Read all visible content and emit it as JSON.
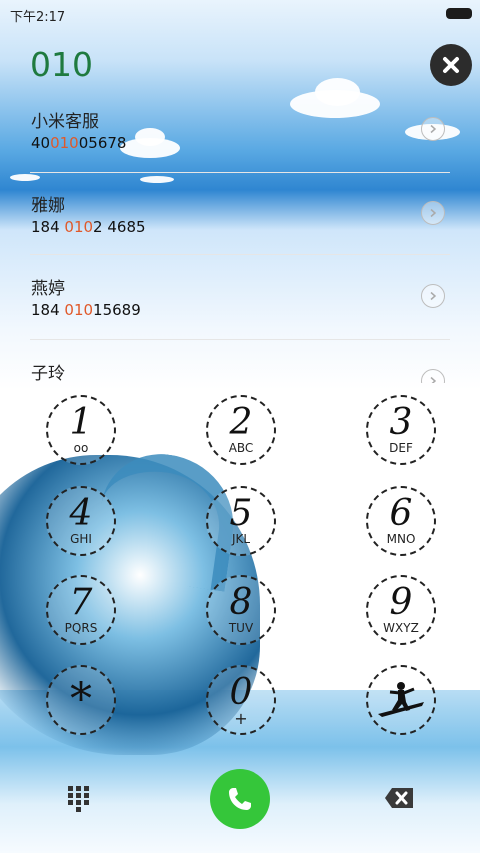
{
  "status_bar": {
    "time": "下午2:17"
  },
  "query": "010",
  "contacts": [
    {
      "name": "小米客服",
      "number_pre": "40",
      "number_hl": "010",
      "number_post": "05678"
    },
    {
      "name": "雅娜",
      "number_pre": "184 ",
      "number_hl": "010",
      "number_post": "2 4685"
    },
    {
      "name": "燕婷",
      "number_pre": "184 ",
      "number_hl": "010",
      "number_post": "15689"
    },
    {
      "name": "子玲",
      "number_pre": "",
      "number_hl": "",
      "number_post": ""
    }
  ],
  "keypad": [
    {
      "digit": "1",
      "letters": "oo"
    },
    {
      "digit": "2",
      "letters": "ABC"
    },
    {
      "digit": "3",
      "letters": "DEF"
    },
    {
      "digit": "4",
      "letters": "GHI"
    },
    {
      "digit": "5",
      "letters": "JKL"
    },
    {
      "digit": "6",
      "letters": "MNO"
    },
    {
      "digit": "7",
      "letters": "PQRS"
    },
    {
      "digit": "8",
      "letters": "TUV"
    },
    {
      "digit": "9",
      "letters": "WXYZ"
    },
    {
      "digit": "*",
      "letters": ""
    },
    {
      "digit": "0",
      "letters": "+"
    },
    {
      "digit": "",
      "letters": ""
    }
  ],
  "icons": {
    "close": "close-icon",
    "arrow": "chevron-right-icon",
    "keypad_toggle": "dialpad-icon",
    "call": "phone-icon",
    "backspace": "backspace-icon"
  },
  "colors": {
    "query": "#1f7a3f",
    "highlight": "#e0592a",
    "call_button": "#35c63a"
  }
}
